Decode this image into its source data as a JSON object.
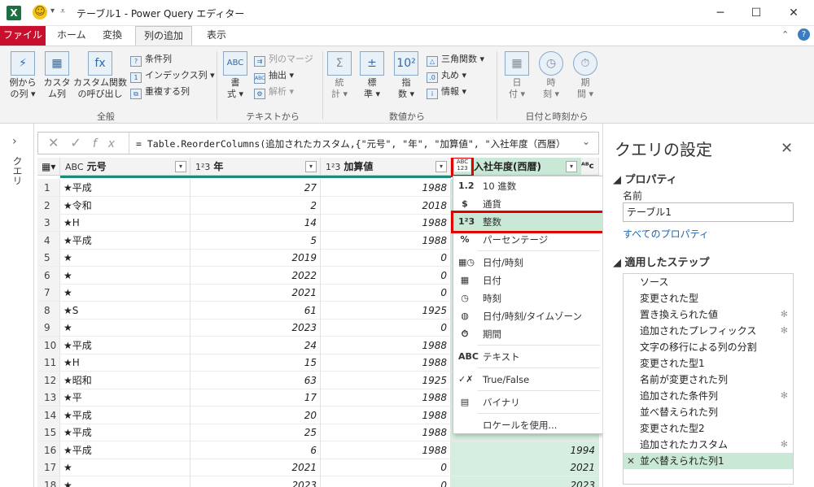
{
  "window": {
    "title": "テーブル1 - Power Query エディター",
    "minimize": "─",
    "maximize": "☐",
    "close": "✕"
  },
  "ribbon_tabs": [
    "ファイル",
    "ホーム",
    "変換",
    "列の追加",
    "表示"
  ],
  "ribbon": {
    "general": {
      "btn1": "例から\n の列 ▾",
      "btn1_a": "例から",
      "btn1_b": "の列 ▾",
      "btn2_a": "カスタ",
      "btn2_b": "ム列",
      "btn3_a": "カスタム関数",
      "btn3_b": "の呼び出し",
      "cond": "条件列",
      "index": "インデックス列 ▾",
      "dup": "重複する列",
      "label": "全般"
    },
    "text": {
      "format_a": "書",
      "format_b": "式 ▾",
      "merge": "列のマージ",
      "extract": "抽出 ▾",
      "parse": "解析 ▾",
      "label": "テキストから"
    },
    "number": {
      "stats_a": "統",
      "stats_b": "計 ▾",
      "std_a": "標",
      "std_b": "準 ▾",
      "sci_a": "指",
      "sci_b": "数 ▾",
      "trig": "三角関数 ▾",
      "round": "丸め ▾",
      "info": "情報 ▾",
      "label": "数値から"
    },
    "datetime": {
      "date_a": "日",
      "date_b": "付 ▾",
      "time_a": "時",
      "time_b": "刻 ▾",
      "dur_a": "期",
      "dur_b": "間 ▾",
      "label": "日付と時刻から"
    }
  },
  "query_pane_label": "クエリ",
  "formula": "= Table.ReorderColumns(追加されたカスタム,{\"元号\", \"年\", \"加算値\", \"入社年度（西暦）",
  "columns": [
    {
      "type": "ABC",
      "name": "元号"
    },
    {
      "type": "1²3",
      "name": "年"
    },
    {
      "type": "1²3",
      "name": "加算値"
    },
    {
      "type": "ABC 123",
      "name": "入社年度(西暦)"
    }
  ],
  "rows": [
    [
      "1",
      "★平成",
      "27",
      "1988",
      ""
    ],
    [
      "2",
      "★令和",
      "2",
      "2018",
      ""
    ],
    [
      "3",
      "★H",
      "14",
      "1988",
      ""
    ],
    [
      "4",
      "★平成",
      "5",
      "1988",
      ""
    ],
    [
      "5",
      "★",
      "2019",
      "0",
      ""
    ],
    [
      "6",
      "★",
      "2022",
      "0",
      ""
    ],
    [
      "7",
      "★",
      "2021",
      "0",
      ""
    ],
    [
      "8",
      "★S",
      "61",
      "1925",
      ""
    ],
    [
      "9",
      "★",
      "2023",
      "0",
      ""
    ],
    [
      "10",
      "★平成",
      "24",
      "1988",
      ""
    ],
    [
      "11",
      "★H",
      "15",
      "1988",
      ""
    ],
    [
      "12",
      "★昭和",
      "63",
      "1925",
      ""
    ],
    [
      "13",
      "★平",
      "17",
      "1988",
      ""
    ],
    [
      "14",
      "★平成",
      "20",
      "1988",
      ""
    ],
    [
      "15",
      "★平成",
      "25",
      "1988",
      ""
    ],
    [
      "16",
      "★平成",
      "6",
      "1988",
      "1994"
    ],
    [
      "17",
      "★",
      "2021",
      "0",
      "2021"
    ],
    [
      "18",
      "★",
      "2023",
      "0",
      "2023"
    ]
  ],
  "type_menu": [
    {
      "icon": "1.2",
      "label": "10 進数"
    },
    {
      "icon": "$",
      "label": "通貨"
    },
    {
      "icon": "1²3",
      "label": "整数"
    },
    {
      "icon": "%",
      "label": "パーセンテージ"
    },
    {
      "icon": "▦◷",
      "label": "日付/時刻"
    },
    {
      "icon": "▦",
      "label": "日付"
    },
    {
      "icon": "◷",
      "label": "時刻"
    },
    {
      "icon": "◍",
      "label": "日付/時刻/タイムゾーン"
    },
    {
      "icon": "⏱",
      "label": "期間"
    },
    {
      "icon": "ABC",
      "label": "テキスト"
    },
    {
      "icon": "✓✗",
      "label": "True/False"
    },
    {
      "icon": "▤",
      "label": "バイナリ"
    },
    {
      "icon": "",
      "label": "ロケールを使用..."
    }
  ],
  "settings": {
    "title": "クエリの設定",
    "properties": "◢ プロパティ",
    "name_label": "名前",
    "name_value": "テーブル1",
    "all_props": "すべてのプロパティ",
    "applied_steps": "◢ 適用したステップ",
    "steps": [
      {
        "label": "ソース",
        "gear": false
      },
      {
        "label": "変更された型",
        "gear": false
      },
      {
        "label": "置き換えられた値",
        "gear": true
      },
      {
        "label": "追加されたプレフィックス",
        "gear": true
      },
      {
        "label": "文字の移行による列の分割",
        "gear": false
      },
      {
        "label": "変更された型1",
        "gear": false
      },
      {
        "label": "名前が変更された列",
        "gear": false
      },
      {
        "label": "追加された条件列",
        "gear": true
      },
      {
        "label": "並べ替えられた列",
        "gear": false
      },
      {
        "label": "変更された型2",
        "gear": false
      },
      {
        "label": "追加されたカスタム",
        "gear": true
      },
      {
        "label": "並べ替えられた列1",
        "gear": false
      }
    ]
  },
  "colors": {
    "file_tab": "#c8102e",
    "accent_green": "#c9e8d6",
    "highlight_red": "#e00000"
  }
}
